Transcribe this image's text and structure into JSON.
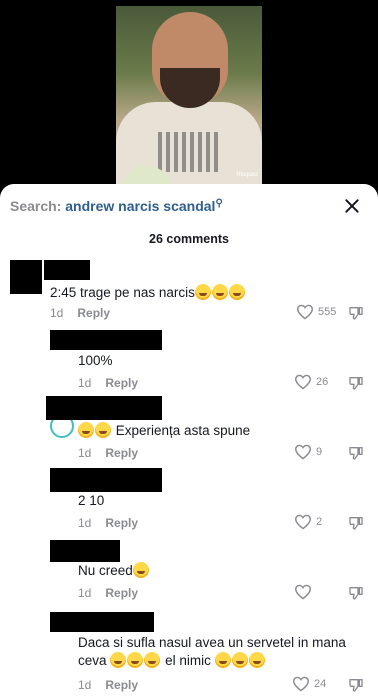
{
  "video": {
    "badge": "Risquez"
  },
  "search": {
    "label": "Search:",
    "query": "andrew narcis scandal"
  },
  "comments_count": "26 comments",
  "comments": [
    {
      "text": "2:45 trage pe nas narcis",
      "emoji_count": 3,
      "time": "1d",
      "reply": "Reply",
      "likes": "555"
    },
    {
      "text": "100%",
      "time": "1d",
      "reply": "Reply",
      "likes": "26"
    },
    {
      "text": "Experiența asta spune",
      "emoji_count_before": 2,
      "time": "1d",
      "reply": "Reply",
      "likes": "9"
    },
    {
      "text": "2 10",
      "time": "1d",
      "reply": "Reply",
      "likes": "2"
    },
    {
      "text": "Nu creed",
      "emoji_count": 1,
      "time": "1d",
      "reply": "Reply",
      "likes": ""
    },
    {
      "text_line1": "Daca si sufla nasul avea un servetel in mana",
      "text_line2a": "ceva",
      "text_line2b": "el nimic",
      "time": "1d",
      "reply": "Reply",
      "likes": "24"
    }
  ],
  "colors": {
    "accent": "#2f5f8f",
    "secondary_text": "#8a8b91",
    "primary_text": "#161823"
  }
}
